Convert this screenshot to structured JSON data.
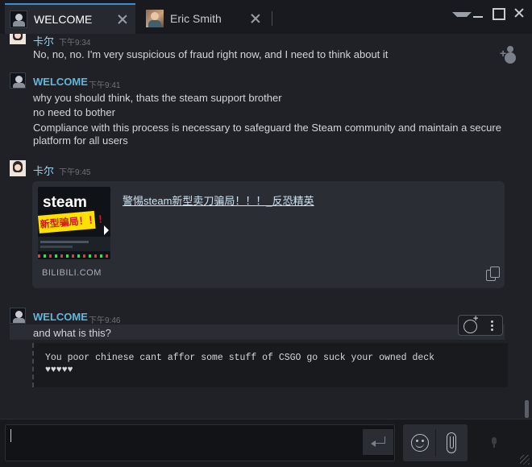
{
  "tabs": [
    {
      "name": "WELCOME",
      "active": true,
      "avatar": "steam-avatar-icon"
    },
    {
      "name": "Eric Smith",
      "active": false,
      "avatar": "profile-photo-icon"
    }
  ],
  "messages": [
    {
      "sender": "卡尔",
      "time": "下午9:34",
      "lines": [
        "No, no, no. I'm very suspicious of fraud right now, and I need to think about it"
      ]
    },
    {
      "sender": "WELCOME",
      "time": "下午9:41",
      "lines": [
        "why you should think, thats the steam support brother",
        "no need to bother",
        "Compliance with this process is necessary to safeguard the Steam community and maintain a secure",
        "platform for all users"
      ]
    },
    {
      "sender": "卡尔",
      "time": "下午9:45",
      "embed": {
        "title": "警惕steam新型卖刀骗局！！！_反恐精英",
        "domain": "BILIBILI.COM",
        "thumbnail_word": "steam",
        "thumbnail_caption": "新型骗局！！！"
      }
    },
    {
      "sender": "WELCOME",
      "time": "下午9:46",
      "lines": [
        "and what is this?"
      ],
      "code": "You poor chinese cant affor some stuff of CSGO go suck your owned deck\n♥♥♥♥♥"
    }
  ],
  "composer": {
    "value": "",
    "placeholder": ""
  },
  "colors": {
    "accent": "#3d8bd0",
    "sender_welcome": "#5fb8dc",
    "background": "#1f2126"
  }
}
